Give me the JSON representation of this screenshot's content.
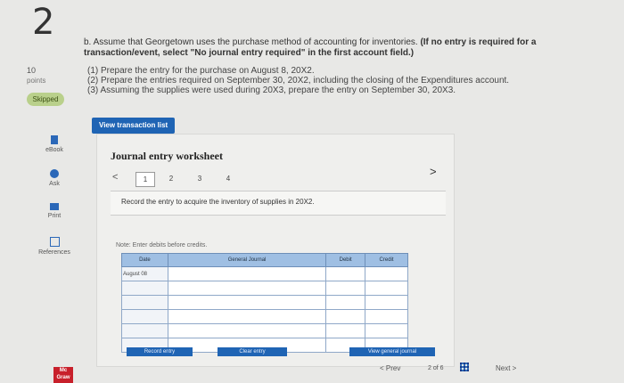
{
  "question": {
    "number": "2",
    "points_value": "10",
    "points_label": "points",
    "status": "Skipped"
  },
  "sidebar": {
    "tools": [
      {
        "label": "eBook",
        "icon": "ebook-icon"
      },
      {
        "label": "Ask",
        "icon": "ask-icon"
      },
      {
        "label": "Print",
        "icon": "print-icon"
      },
      {
        "label": "References",
        "icon": "references-icon"
      }
    ]
  },
  "instructions": {
    "part": "b. Assume that Georgetown uses the purchase method of accounting for inventories. ",
    "bold": "(If no entry is required for a transaction/event, select \"No journal entry required\" in the first account field.)",
    "requirements": [
      "(1) Prepare the entry for the purchase on August 8, 20X2.",
      "(2) Prepare the entries required on September 30, 20X2, including the closing of the Expenditures account.",
      "(3) Assuming the supplies were used during 20X3, prepare the entry on September 30, 20X3."
    ]
  },
  "view_transaction_list": "View transaction list",
  "worksheet": {
    "title": "Journal entry worksheet",
    "pages": [
      "1",
      "2",
      "3",
      "4"
    ],
    "prev": "<",
    "next": ">",
    "task": "Record the entry to acquire the inventory of supplies in 20X2.",
    "note": "Note: Enter debits before credits.",
    "columns": [
      "Date",
      "General Journal",
      "Debit",
      "Credit"
    ],
    "first_date": "August 08",
    "buttons": {
      "record": "Record entry",
      "clear": "Clear entry",
      "view": "View general journal"
    }
  },
  "nav": {
    "prev": "< Prev",
    "page": "2 of 6",
    "next": "Next >"
  },
  "brand": {
    "logo": "Mc Graw"
  }
}
